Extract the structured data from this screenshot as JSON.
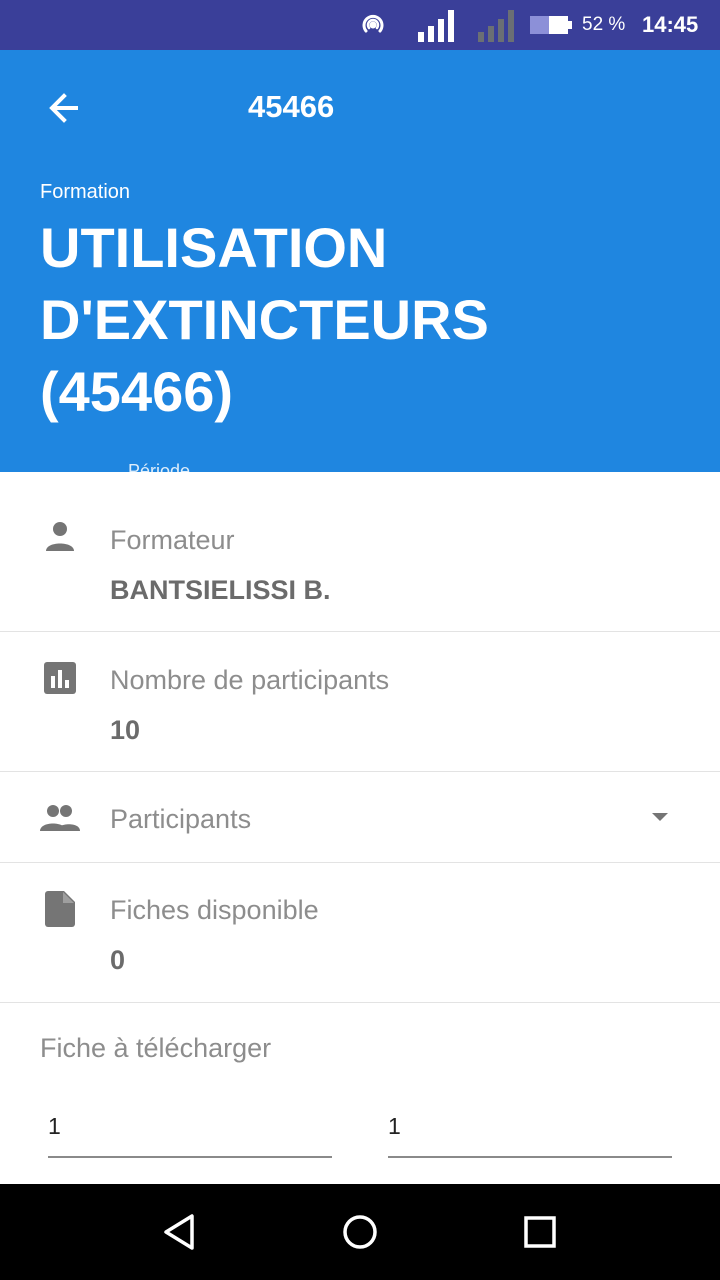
{
  "status_bar": {
    "battery_percent": "52 %",
    "time": "14:45",
    "icons": [
      "hotspot-icon",
      "signal-icon",
      "signal-weak-icon",
      "battery-icon"
    ]
  },
  "toolbar": {
    "title": "45466",
    "back_icon": "arrow-left-icon"
  },
  "header": {
    "subtitle": "Formation",
    "title": "UTILISATION D'EXTINCTEURS (45466)",
    "partial_label": "Période",
    "background_color": "#1f86e0"
  },
  "rows": {
    "formateur": {
      "icon": "person-icon",
      "label": "Formateur",
      "value": "BANTSIELISSI B."
    },
    "nombre": {
      "icon": "bar-chart-icon",
      "label": "Nombre de participants",
      "value": "10"
    },
    "participants": {
      "icon": "group-icon",
      "label": "Participants",
      "arrow_icon": "dropdown-arrow-icon"
    },
    "fiches": {
      "icon": "file-icon",
      "label": "Fiches disponible",
      "value": "0"
    }
  },
  "download": {
    "title": "Fiche à télécharger",
    "field_1": "1",
    "field_2": "1"
  },
  "nav_bar": {
    "icons": [
      "nav-back-icon",
      "nav-home-icon",
      "nav-recent-icon"
    ]
  }
}
